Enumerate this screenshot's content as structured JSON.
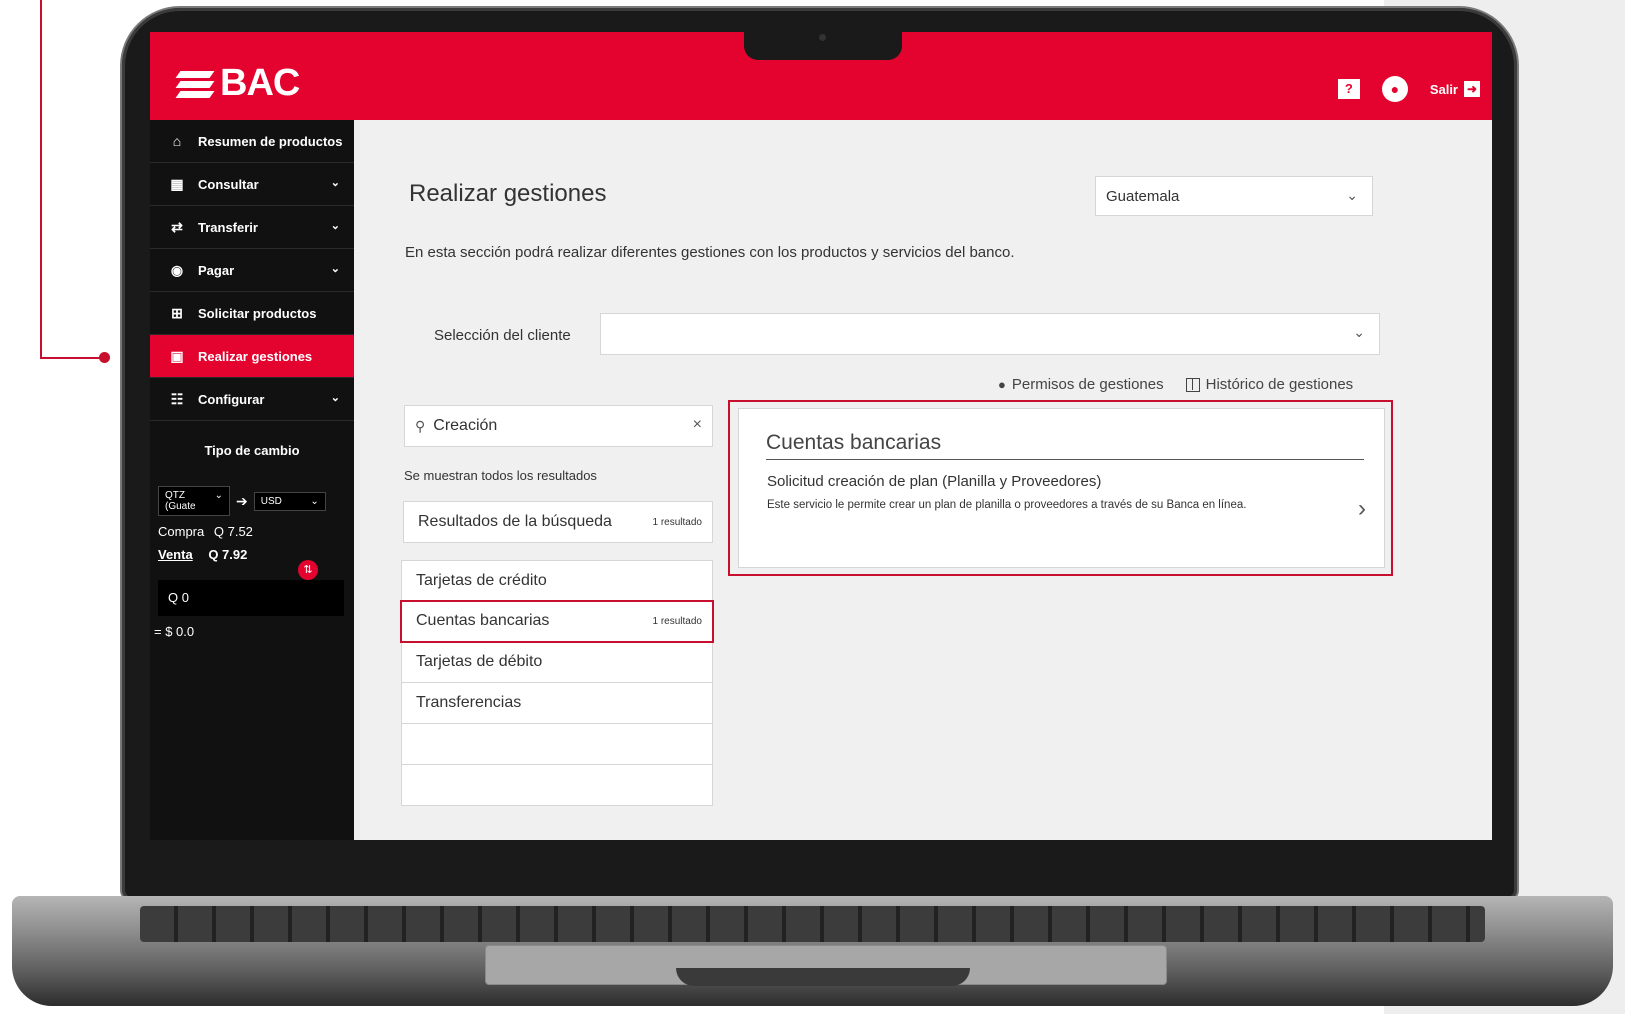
{
  "brand": {
    "name": "BAC"
  },
  "topbar": {
    "help": "?",
    "exit_label": "Salir"
  },
  "sidebar": {
    "items": [
      {
        "label": "Resumen de productos",
        "icon": "home-icon"
      },
      {
        "label": "Consultar",
        "icon": "grid-icon"
      },
      {
        "label": "Transferir",
        "icon": "transfer-icon"
      },
      {
        "label": "Pagar",
        "icon": "bag-icon"
      },
      {
        "label": "Solicitar productos",
        "icon": "plus-icon"
      },
      {
        "label": "Realizar gestiones",
        "icon": "laptop-icon"
      },
      {
        "label": "Configurar",
        "icon": "sliders-icon"
      }
    ],
    "fx": {
      "title": "Tipo de cambio",
      "from": "QTZ (Guate",
      "to": "USD",
      "buy_label": "Compra",
      "buy_value": "Q 7.52",
      "sell_label": "Venta",
      "sell_value": "Q 7.92",
      "input_value": "Q  0",
      "result": "= $ 0.0"
    }
  },
  "main": {
    "title": "Realizar gestiones",
    "country": "Guatemala",
    "description": "En esta sección podrá realizar diferentes gestiones con los productos y servicios del banco.",
    "client_label": "Selección del cliente",
    "permissions_link": "Permisos de gestiones",
    "history_link": "Histórico de gestiones",
    "search": {
      "value": "Creación",
      "note": "Se muestran todos los resultados"
    },
    "results": {
      "label": "Resultados de la búsqueda",
      "count": "1 resultado"
    },
    "categories": [
      {
        "label": "Tarjetas de crédito",
        "count": ""
      },
      {
        "label": "Cuentas bancarias",
        "count": "1 resultado"
      },
      {
        "label": "Tarjetas de débito",
        "count": ""
      },
      {
        "label": "Transferencias",
        "count": ""
      }
    ],
    "detail": {
      "title": "Cuentas bancarias",
      "item_title": "Solicitud creación de plan (Planilla y Proveedores)",
      "item_desc": "Este servicio le permite crear un plan de planilla o proveedores a través de su Banca en línea."
    }
  },
  "colors": {
    "brand_red": "#e4032e",
    "highlight_red": "#c8102e",
    "sidebar_bg": "#111111"
  }
}
